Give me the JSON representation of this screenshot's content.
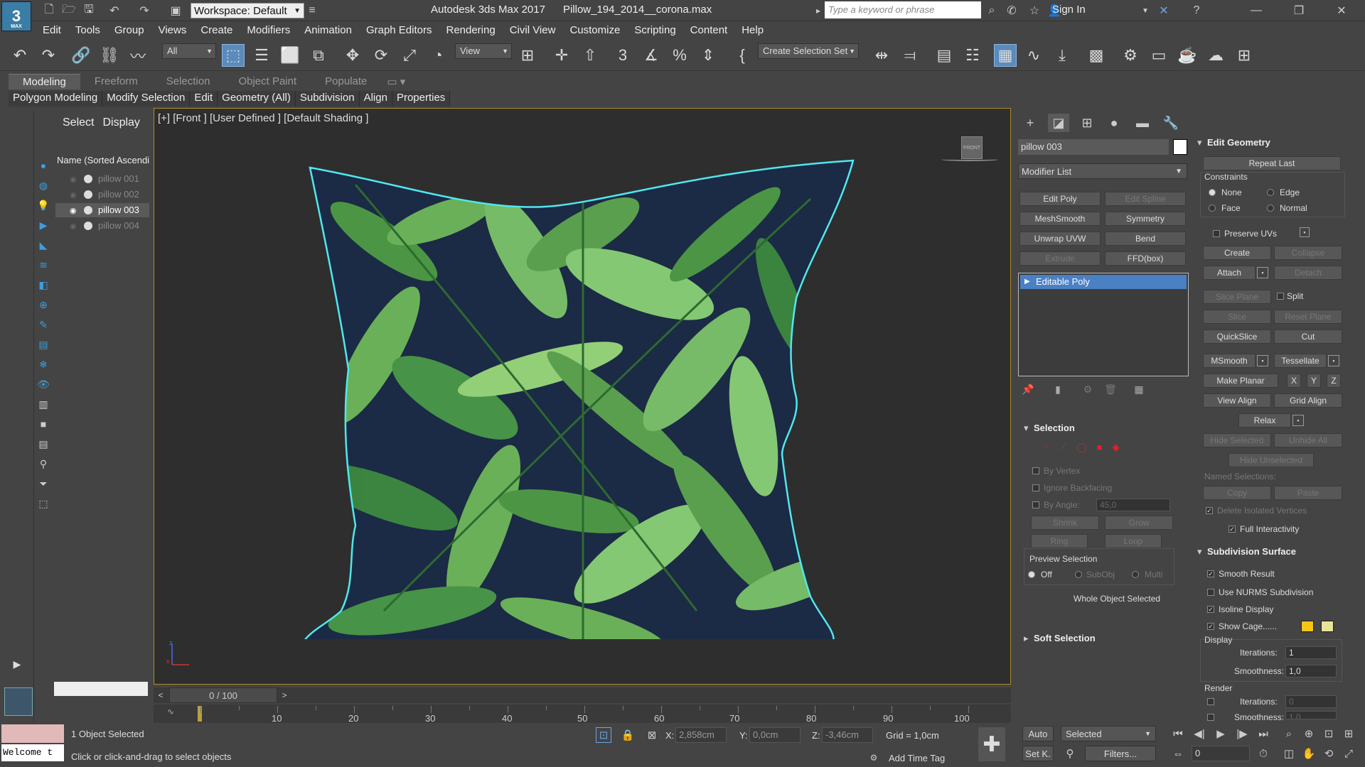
{
  "titlebar": {
    "workspace": "Workspace: Default",
    "app_title": "Autodesk 3ds Max 2017      Pillow_194_2014__corona.max",
    "search_placeholder": "Type a keyword or phrase",
    "sign_in": "Sign In",
    "logo": "3",
    "logo_sub": "MAX"
  },
  "menu": [
    "Edit",
    "Tools",
    "Group",
    "Views",
    "Create",
    "Modifiers",
    "Animation",
    "Graph Editors",
    "Rendering",
    "Civil View",
    "Customize",
    "Scripting",
    "Content",
    "Help"
  ],
  "toolbar": {
    "selection_filter": "All",
    "ref_coord": "View",
    "selection_set": "Create Selection Set"
  },
  "ribbon": {
    "tabs": [
      "Modeling",
      "Freeform",
      "Selection",
      "Object Paint",
      "Populate"
    ],
    "panels": [
      "Polygon Modeling",
      "Modify Selection",
      "Edit",
      "Geometry (All)",
      "Subdivision",
      "Align",
      "Properties"
    ]
  },
  "explorer": {
    "tabs": [
      "Select",
      "Display"
    ],
    "header": "Name (Sorted Ascendi",
    "items": [
      {
        "name": "pillow 001",
        "selected": false
      },
      {
        "name": "pillow 002",
        "selected": false
      },
      {
        "name": "pillow 003",
        "selected": true
      },
      {
        "name": "pillow 004",
        "selected": false
      }
    ]
  },
  "viewport": {
    "label": "[+] [Front ] [User Defined ] [Default Shading ]",
    "viewcube_label": "FRONT"
  },
  "timeline": {
    "slider": "0 / 100",
    "ticks": [
      "10",
      "20",
      "30",
      "40",
      "50",
      "60",
      "70",
      "80",
      "90",
      "100"
    ]
  },
  "command_panel": {
    "object_name": "pillow 003",
    "object_color": "#ffffff",
    "modifier_list": "Modifier List",
    "mod_buttons": [
      {
        "label": "Edit Poly",
        "enabled": true
      },
      {
        "label": "Edit Spline",
        "enabled": false
      },
      {
        "label": "MeshSmooth",
        "enabled": true
      },
      {
        "label": "Symmetry",
        "enabled": true
      },
      {
        "label": "Unwrap UVW",
        "enabled": true
      },
      {
        "label": "Bend",
        "enabled": true
      },
      {
        "label": "Extrude",
        "enabled": false
      },
      {
        "label": "FFD(box)",
        "enabled": true
      }
    ],
    "stack_item": "Editable Poly",
    "selection": {
      "title": "Selection",
      "by_vertex": "By Vertex",
      "ignore_backfacing": "Ignore Backfacing",
      "by_angle": "By Angle:",
      "angle_value": "45,0",
      "shrink": "Shrink",
      "grow": "Grow",
      "ring": "Ring",
      "loop": "Loop",
      "preview": "Preview Selection",
      "off": "Off",
      "subobj": "SubObj",
      "multi": "Multi",
      "status": "Whole Object Selected"
    },
    "soft_selection": "Soft Selection",
    "edit_geometry": {
      "title": "Edit Geometry",
      "repeat_last": "Repeat Last",
      "constraints": "Constraints",
      "none": "None",
      "edge": "Edge",
      "face": "Face",
      "normal": "Normal",
      "preserve_uvs": "Preserve UVs",
      "create": "Create",
      "collapse": "Collapse",
      "attach": "Attach",
      "detach": "Detach",
      "slice_plane": "Slice Plane",
      "split": "Split",
      "slice": "Slice",
      "reset_plane": "Reset Plane",
      "quickslice": "QuickSlice",
      "cut": "Cut",
      "msmooth": "MSmooth",
      "tessellate": "Tessellate",
      "make_planar": "Make Planar",
      "x": "X",
      "y": "Y",
      "z": "Z",
      "view_align": "View Align",
      "grid_align": "Grid Align",
      "relax": "Relax",
      "hide_selected": "Hide Selected",
      "unhide_all": "Unhide All",
      "hide_unselected": "Hide Unselected",
      "named_selections": "Named Selections:",
      "copy": "Copy",
      "paste": "Paste",
      "delete_isolated": "Delete Isolated Vertices",
      "full_interactivity": "Full Interactivity"
    },
    "subdivision": {
      "title": "Subdivision Surface",
      "smooth_result": "Smooth Result",
      "use_nurms": "Use NURMS Subdivision",
      "isoline": "Isoline Display",
      "show_cage": "Show Cage......",
      "cage_color1": "#f5c518",
      "cage_color2": "#e8e39a",
      "display": "Display",
      "iterations": "Iterations:",
      "iterations_value": "1",
      "smoothness": "Smoothness:",
      "smoothness_value": "1,0",
      "render": "Render",
      "render_iterations_value": "0",
      "render_smoothness_value": "1,0"
    }
  },
  "status": {
    "objects_selected": "1 Object Selected",
    "prompt": "Click or click-and-drag to select objects",
    "welcome": "Welcome t",
    "x_label": "X:",
    "x_value": "2,858cm",
    "y_label": "Y:",
    "y_value": "0,0cm",
    "z_label": "Z:",
    "z_value": "-3,46cm",
    "grid": "Grid = 1,0cm",
    "add_time_tag": "Add Time Tag",
    "auto": "Auto",
    "set_key": "Set K.",
    "selected": "Selected",
    "filters": "Filters...",
    "frame": "0"
  },
  "colors": {
    "accent": "#5a8bbd",
    "viewport_border": "#b08a2b",
    "selection_outline": "#4fe8ef",
    "pillow_base": "#1b2a45",
    "leaf": "#4f9b45"
  }
}
